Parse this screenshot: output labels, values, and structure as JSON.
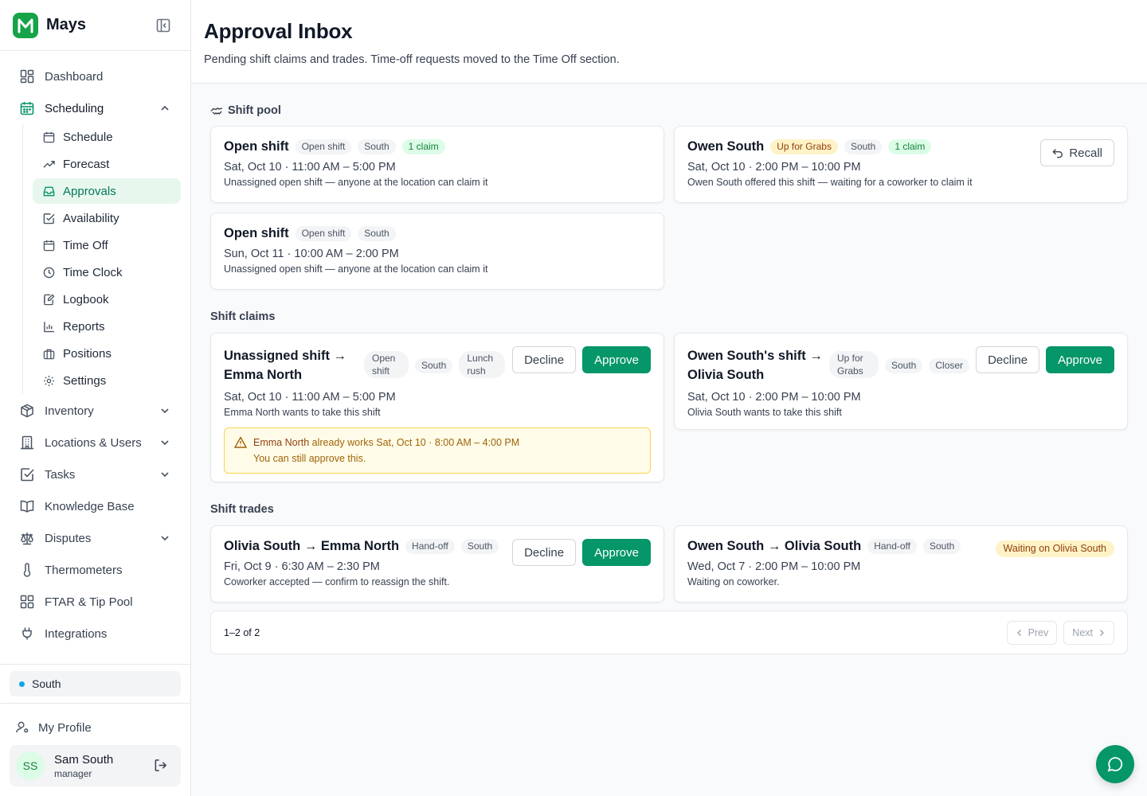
{
  "app": {
    "name": "Mays"
  },
  "nav": {
    "dashboard": "Dashboard",
    "scheduling": "Scheduling",
    "scheduling_items": [
      "Schedule",
      "Forecast",
      "Approvals",
      "Availability",
      "Time Off",
      "Time Clock",
      "Logbook",
      "Reports",
      "Positions",
      "Settings"
    ],
    "inventory": "Inventory",
    "locations_users": "Locations & Users",
    "tasks": "Tasks",
    "knowledge_base": "Knowledge Base",
    "disputes": "Disputes",
    "thermometers": "Thermometers",
    "ftar": "FTAR & Tip Pool",
    "integrations": "Integrations"
  },
  "location": {
    "name": "South"
  },
  "profile": {
    "link": "My Profile",
    "initials": "SS",
    "name": "Sam South",
    "role": "manager"
  },
  "header": {
    "title": "Approval Inbox",
    "subtitle": "Pending shift claims and trades. Time-off requests moved to the Time Off section."
  },
  "sections": {
    "pool": "Shift pool",
    "claims": "Shift claims",
    "trades": "Shift trades"
  },
  "pool": [
    {
      "title": "Open shift",
      "badges": [
        "Open shift",
        "South",
        "1 claim"
      ],
      "time": "Sat, Oct 10 · 11:00 AM – 5:00 PM",
      "desc": "Unassigned open shift — anyone at the location can claim it"
    },
    {
      "title": "Owen South",
      "badges": [
        "Up for Grabs",
        "South",
        "1 claim"
      ],
      "time": "Sat, Oct 10 · 2:00 PM – 10:00 PM",
      "desc": "Owen South offered this shift — waiting for a coworker to claim it",
      "action": "Recall"
    },
    {
      "title": "Open shift",
      "badges": [
        "Open shift",
        "South"
      ],
      "time": "Sun, Oct 11 · 10:00 AM – 2:00 PM",
      "desc": "Unassigned open shift — anyone at the location can claim it"
    }
  ],
  "claims": [
    {
      "title_line1": "Unassigned shift →",
      "title_line2": "Emma North",
      "badges": [
        "Open shift",
        "South",
        "Lunch rush"
      ],
      "time": "Sat, Oct 10 · 11:00 AM – 5:00 PM",
      "desc": "Emma North wants to take this shift",
      "warning": {
        "name": "Emma North",
        "text": "already works Sat, Oct 10 · 8:00 AM – 4:00 PM",
        "note": "You can still approve this."
      }
    },
    {
      "title_line1": "Owen South's shift →",
      "title_line2": "Olivia South",
      "badges": [
        "Up for Grabs",
        "South",
        "Closer"
      ],
      "time": "Sat, Oct 10 · 2:00 PM – 10:00 PM",
      "desc": "Olivia South wants to take this shift"
    }
  ],
  "trades": [
    {
      "title": "Olivia South → Emma North",
      "badges": [
        "Hand-off",
        "South"
      ],
      "time": "Fri, Oct 9 · 6:30 AM – 2:30 PM",
      "desc": "Coworker accepted — confirm to reassign the shift."
    },
    {
      "title": "Owen South → Olivia South",
      "badges": [
        "Hand-off",
        "South"
      ],
      "status": "Waiting on Olivia South",
      "time": "Wed, Oct 7 · 2:00 PM – 10:00 PM",
      "desc": "Waiting on coworker."
    }
  ],
  "buttons": {
    "decline": "Decline",
    "approve": "Approve"
  },
  "pagination": {
    "range": "1–2 of 2",
    "prev": "Prev",
    "next": "Next"
  },
  "colors": {
    "accent": "#059669",
    "active_bg": "#e8f7ee",
    "warning_bg": "#fefce8",
    "claim_badge": "#dcfce7",
    "grabs_badge": "#fef3c7"
  }
}
